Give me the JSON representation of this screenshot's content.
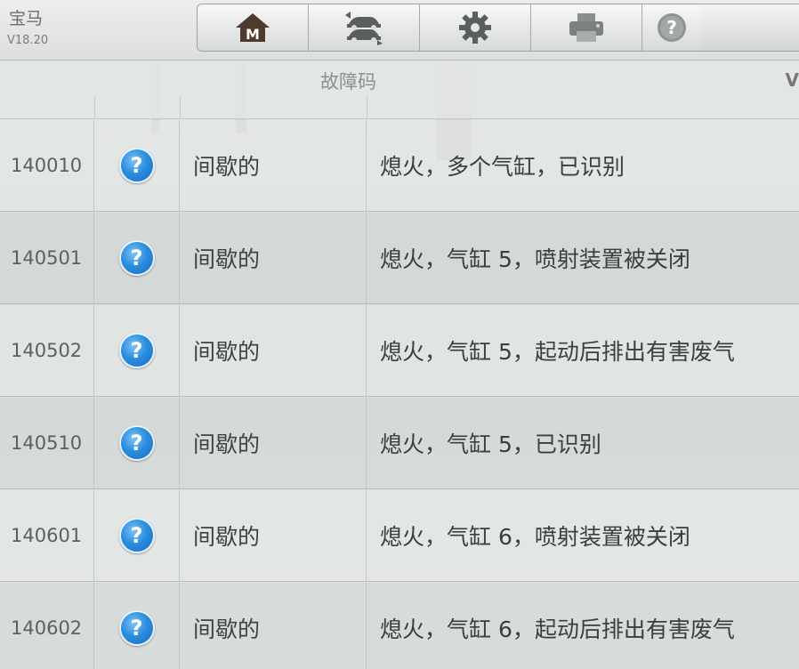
{
  "header": {
    "app_title": "宝马",
    "version": "V18.20"
  },
  "toolbar": {
    "buttons": [
      {
        "name": "home-button",
        "icon": "home-m-icon"
      },
      {
        "name": "vehicle-swap-button",
        "icon": "vehicle-swap-icon"
      },
      {
        "name": "settings-button",
        "icon": "gear-icon"
      },
      {
        "name": "print-button",
        "icon": "printer-icon"
      },
      {
        "name": "help-button",
        "icon": "help-icon"
      }
    ]
  },
  "table": {
    "header_title": "故障码",
    "header_edge": "V",
    "rows": [
      {
        "code": "140010",
        "status": "间歇的",
        "description": "熄火，多个气缸，已识别"
      },
      {
        "code": "140501",
        "status": "间歇的",
        "description": "熄火，气缸 5，喷射装置被关闭"
      },
      {
        "code": "140502",
        "status": "间歇的",
        "description": "熄火，气缸 5，起动后排出有害废气"
      },
      {
        "code": "140510",
        "status": "间歇的",
        "description": "熄火，气缸 5，已识别"
      },
      {
        "code": "140601",
        "status": "间歇的",
        "description": "熄火，气缸 6，喷射装置被关闭"
      },
      {
        "code": "140602",
        "status": "间歇的",
        "description": "熄火，气缸 6，起动后排出有害废气"
      }
    ]
  },
  "colors": {
    "help_icon": "#2b8fe0",
    "toolbar_icon": "#5a5f5e",
    "text": "#3a3f3e"
  }
}
